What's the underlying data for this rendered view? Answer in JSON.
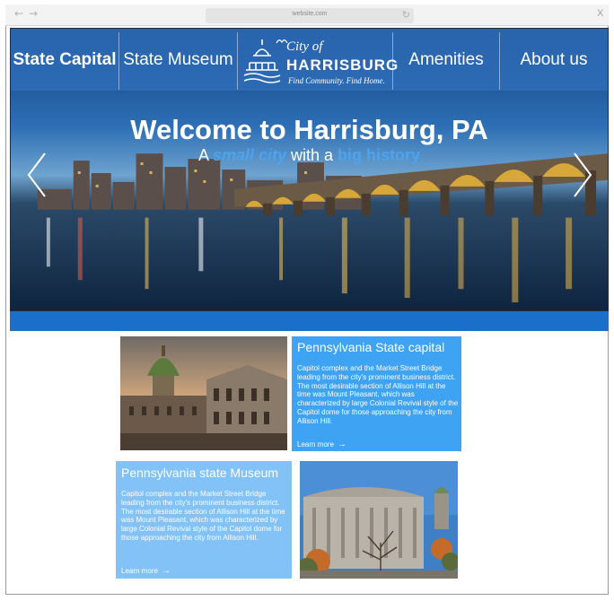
{
  "browser": {
    "url": "website.com",
    "back_icon": "←",
    "forward_icon": "→",
    "reload_icon": "↻",
    "close_icon": "X"
  },
  "nav": {
    "items": [
      {
        "label": "State Capital"
      },
      {
        "label": "State Museum"
      },
      {
        "label": "Amenities"
      },
      {
        "label": "About us"
      }
    ]
  },
  "logo": {
    "city_of": "City of",
    "name": "HARRISBURG",
    "tagline": "Find Community. Find Home."
  },
  "hero": {
    "title": "Welcome to Harrisburg, PA",
    "subtitle_a": "A ",
    "subtitle_em1": "small city",
    "subtitle_b": " with a ",
    "subtitle_em2": "big history"
  },
  "cards": [
    {
      "title": "Pennsylvania State capital",
      "body": "Capitol complex and the Market Street Bridge leading from the city's prominent business district. The most desirable section of Allison Hill at the time was Mount Pleasant, which was characterized by large Colonial Revival style  of the Capitol dome for those approaching the city from Allison Hill.",
      "link": "Learn more"
    },
    {
      "title": "Pennsylvania state Museum",
      "body": "Capitol complex and the Market Street Bridge leading from the city's prominent business district. The most desirable section of Allison Hill at the time was Mount Pleasant, which was characterized by large Colonial Revival style  of the Capitol dome for those approaching the city from Allison Hill.",
      "link": "Learn more"
    }
  ],
  "colors": {
    "nav_blue": "#306eb9",
    "strip_blue": "#1a6fcb",
    "card1_blue": "#3fa3f3",
    "card2_blue": "#83c2f6",
    "accent_text": "#4da3ee"
  }
}
